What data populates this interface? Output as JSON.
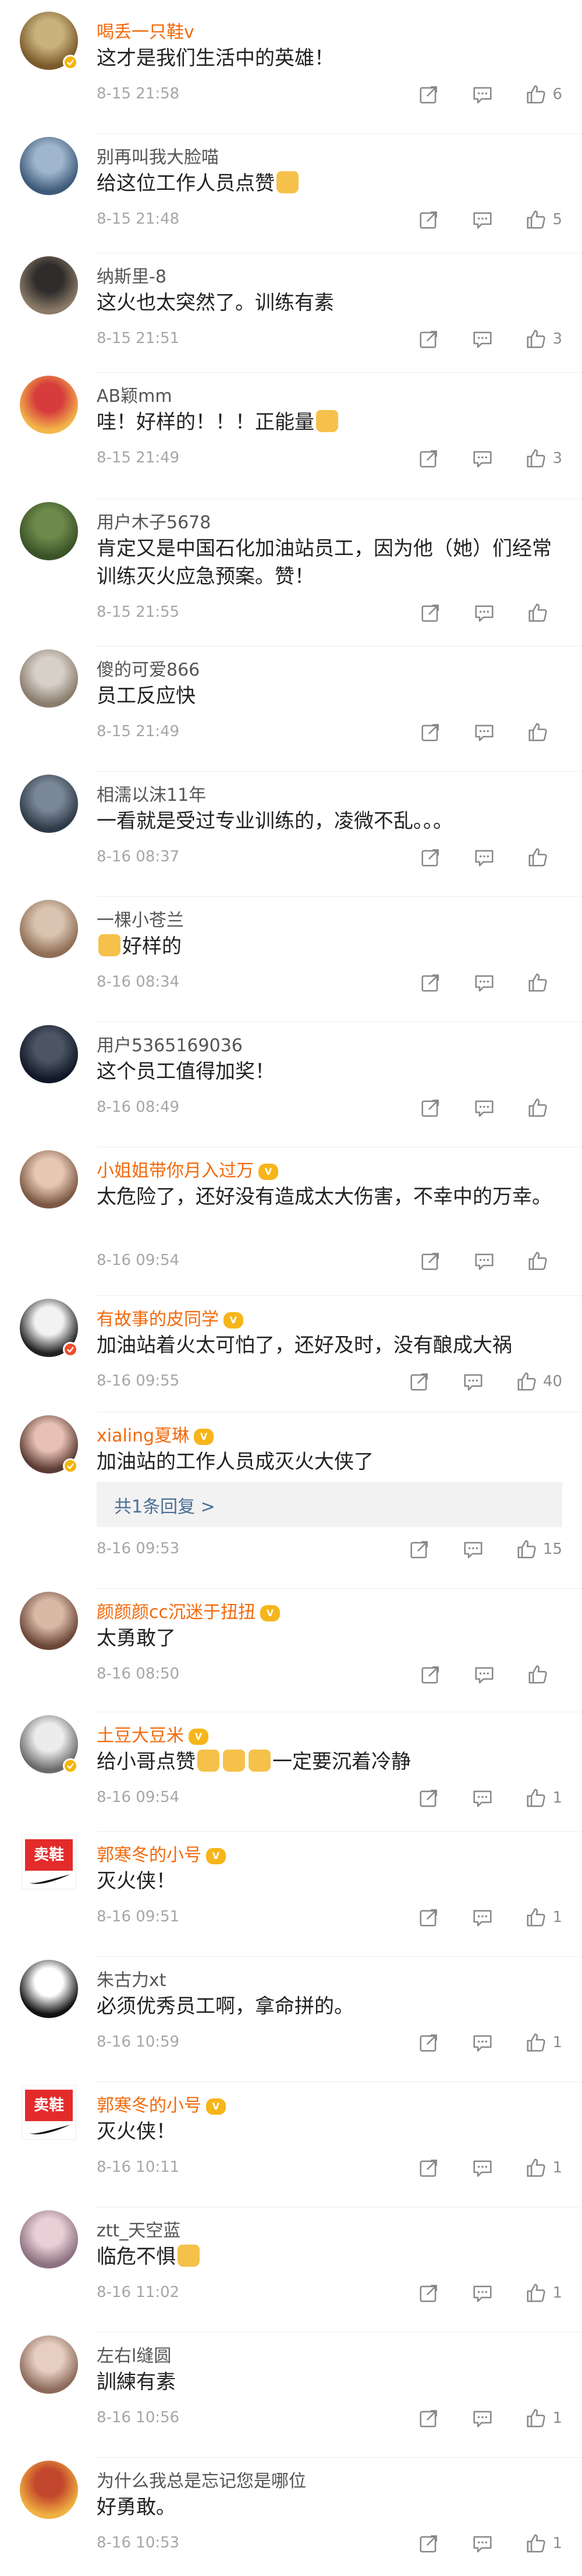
{
  "comments": [
    {
      "name": "喝丢一只鞋v",
      "vip": true,
      "text": "这才是我们生活中的英雄！",
      "time": "8-15 21:58",
      "likes": "6",
      "badge": "yellow"
    },
    {
      "name": "别再叫我大脸喵",
      "vip": false,
      "text": "给这位工作人员点赞",
      "emoji_after": 1,
      "time": "8-15 21:48",
      "likes": "5",
      "badge": ""
    },
    {
      "name": "纳斯里-8",
      "vip": false,
      "text": "这火也太突然了。训练有素",
      "time": "8-15 21:51",
      "likes": "3",
      "badge": ""
    },
    {
      "name": "AB颖mm",
      "vip": false,
      "text": "哇！好样的！！！正能量",
      "emoji_after": 1,
      "time": "8-15 21:49",
      "likes": "3",
      "badge": ""
    },
    {
      "name": "用户木子5678",
      "vip": false,
      "text": "肯定又是中国石化加油站员工，因为他（她）们经常训练灭火应急预案。赞！",
      "time": "8-15 21:55",
      "likes": "",
      "badge": ""
    },
    {
      "name": "傻的可爱866",
      "vip": false,
      "text": "员工反应快",
      "time": "8-15 21:49",
      "likes": "",
      "badge": ""
    },
    {
      "name": "相濡以沫11年",
      "vip": false,
      "text": "一看就是受过专业训练的，凌微不乱。。。",
      "time": "8-16 08:37",
      "likes": "",
      "badge": ""
    },
    {
      "name": "一棵小苍兰",
      "vip": false,
      "text": "好样的",
      "emoji_before": 1,
      "time": "8-16 08:34",
      "likes": "",
      "badge": ""
    },
    {
      "name": "用户5365169036",
      "vip": false,
      "text": "这个员工值得加奖！",
      "time": "8-16 08:49",
      "likes": "",
      "badge": ""
    },
    {
      "name": "小姐姐带你月入过万",
      "vip": true,
      "crown": true,
      "text": "太危险了，还好没有造成太大伤害，不幸中的万幸。",
      "time": "8-16 09:54",
      "likes": "",
      "badge": ""
    },
    {
      "name": "有故事的皮同学",
      "vip": true,
      "crown": true,
      "text": "加油站着火太可怕了，还好及时，没有酿成大祸",
      "time": "8-16 09:55",
      "likes": "40",
      "badge": "red"
    },
    {
      "name": "xialing夏琳",
      "vip": true,
      "crown": true,
      "text": "加油站的工作人员成灭火大侠了",
      "time": "8-16 09:53",
      "likes": "15",
      "badge": "yellow",
      "reply": "共1条回复 >"
    },
    {
      "name": "颜颜颜cc沉迷于扭扭",
      "vip": true,
      "crown": true,
      "text": "太勇敢了",
      "time": "8-16 08:50",
      "likes": "",
      "badge": ""
    },
    {
      "name": "土豆大豆米",
      "vip": true,
      "crown": true,
      "text": "给小哥点赞",
      "emoji_after": 3,
      "text2": "一定要沉着冷静",
      "time": "8-16 09:54",
      "likes": "1",
      "badge": "yellow"
    },
    {
      "name": "郭寒冬的小号",
      "vip": true,
      "crown": true,
      "logo": true,
      "text": "灭火侠！",
      "time": "8-16 09:51",
      "likes": "1",
      "badge": ""
    },
    {
      "name": "朱古力xt",
      "vip": false,
      "text": "必须优秀员工啊，拿命拼的。",
      "time": "8-16 10:59",
      "likes": "1",
      "badge": ""
    },
    {
      "name": "郭寒冬的小号",
      "vip": true,
      "crown": true,
      "logo": true,
      "text": "灭火侠！",
      "time": "8-16 10:11",
      "likes": "1",
      "badge": ""
    },
    {
      "name": "ztt_天空蓝",
      "vip": false,
      "text": "临危不惧",
      "emoji_after": 1,
      "time": "8-16 11:02",
      "likes": "1",
      "badge": ""
    },
    {
      "name": "左右l缝圆",
      "vip": false,
      "text": "訓練有素",
      "time": "8-16 10:56",
      "likes": "1",
      "badge": ""
    },
    {
      "name": "为什么我总是忘记您是哪位",
      "vip": false,
      "text": "好勇敢。",
      "time": "8-16 10:53",
      "likes": "1",
      "badge": ""
    }
  ],
  "logo_text": "卖鞋",
  "crown_text": "V",
  "colors": {
    "vip_name": "#f2690a",
    "normal_name": "#555555",
    "reply_link": "#4a6f96"
  },
  "icons": {
    "repost": "share-icon",
    "comment": "comment-icon",
    "like": "like-icon"
  }
}
